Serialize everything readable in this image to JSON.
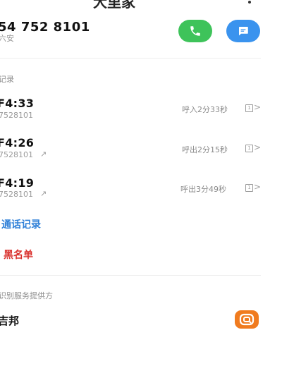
{
  "header": {
    "title": "大里家"
  },
  "contact": {
    "phone_number": "54 752 8101",
    "location": "六安"
  },
  "call_log": {
    "section_label": "记录",
    "entries": [
      {
        "time": "F4:33",
        "number": "7528101",
        "detail": "呼入2分33秒",
        "outgoing": false
      },
      {
        "time": "F4:26",
        "number": "7528101",
        "detail": "呼出2分15秒",
        "outgoing": true
      },
      {
        "time": "F4:19",
        "number": "7528101",
        "detail": "呼出3分49秒",
        "outgoing": true
      }
    ],
    "sim_label": "1",
    "outgoing_arrow": "↗",
    "chevron": ">"
  },
  "actions": {
    "view_all_label": "通话记录",
    "blacklist_label": "黑名单"
  },
  "provider": {
    "section_label": "识别服务提供方",
    "name": "吉邦"
  },
  "colors": {
    "call": "#3ec35a",
    "message": "#3a93ee",
    "link": "#2f80d8",
    "danger": "#d9302c",
    "provider_logo": "#f07b1f"
  }
}
